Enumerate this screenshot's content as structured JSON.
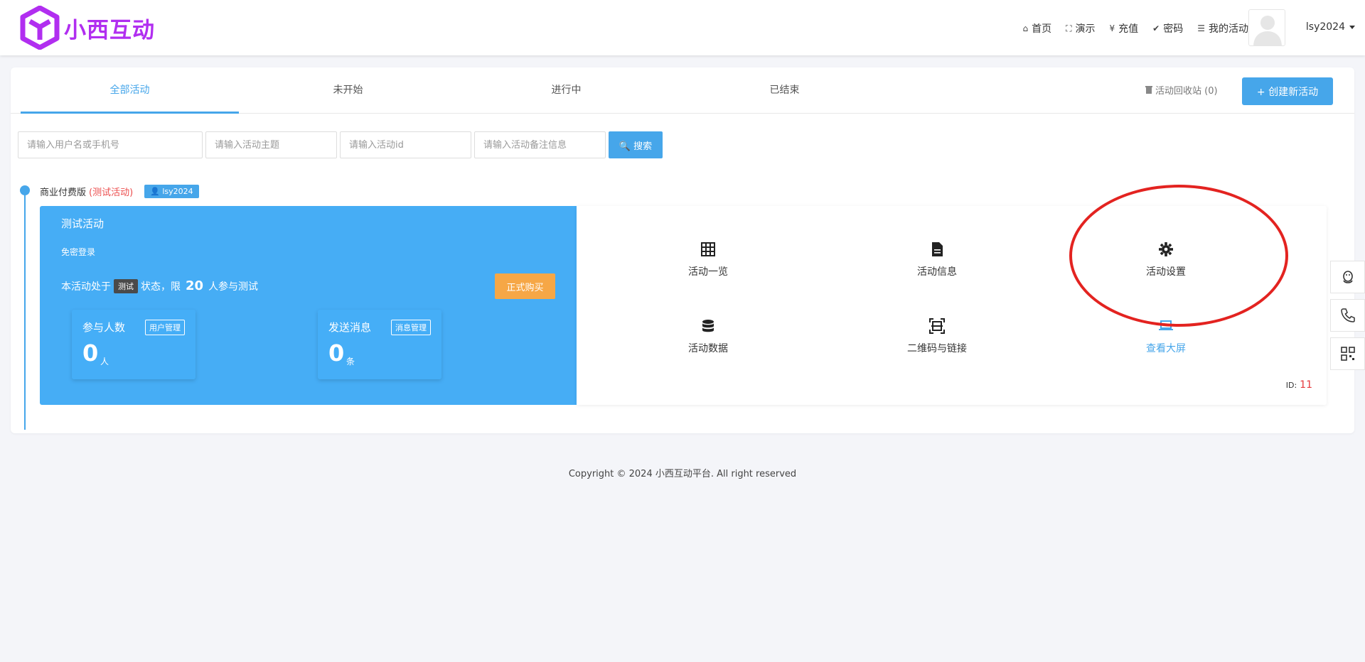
{
  "header": {
    "logo_text": "小西互动",
    "nav": [
      {
        "icon": "home-icon",
        "glyph": "⌂",
        "label": "首页"
      },
      {
        "icon": "fullscreen-icon",
        "glyph": "⛶",
        "label": "演示"
      },
      {
        "icon": "yen-icon",
        "glyph": "¥",
        "label": "充值"
      },
      {
        "icon": "check-circle-icon",
        "glyph": "✔",
        "label": "密码"
      },
      {
        "icon": "list-icon",
        "glyph": "☰",
        "label": "我的活动"
      }
    ],
    "username": "lsy2024"
  },
  "tabs": [
    "全部活动",
    "未开始",
    "进行中",
    "已结束"
  ],
  "recycle_label": "活动回收站 (0)",
  "create_label": "+ 创建新活动",
  "search": {
    "placeholders": [
      "请输入用户名或手机号",
      "请输入活动主题",
      "请输入活动id",
      "请输入活动备注信息"
    ],
    "button_label": "🔍 搜索"
  },
  "group": {
    "title": "商业付费版",
    "tag": "(测试活动)",
    "user": "lsy2024"
  },
  "activity": {
    "title": "测试活动",
    "login": "免密登录",
    "status_prefix": "本活动处于",
    "status_tag": "测试",
    "status_mid": "状态，限",
    "limit": "20",
    "status_suffix": "人参与测试",
    "buy_label": "正式购买",
    "stats": [
      {
        "label": "参与人数",
        "mgmt": "用户管理",
        "value": "0",
        "unit": "人"
      },
      {
        "label": "发送消息",
        "mgmt": "消息管理",
        "value": "0",
        "unit": "条"
      }
    ],
    "ops": [
      {
        "label": "活动一览",
        "icon": "grid-icon"
      },
      {
        "label": "活动信息",
        "icon": "document-icon"
      },
      {
        "label": "活动设置",
        "icon": "gear-icon"
      },
      {
        "label": "活动数据",
        "icon": "database-icon"
      },
      {
        "label": "二维码与链接",
        "icon": "qrcode-scan-icon"
      },
      {
        "label": "查看大屏",
        "icon": "laptop-icon"
      }
    ],
    "id_label": "ID:",
    "id_value": "11"
  },
  "footer": "Copyright © 2024 小西互动平台. All right reserved",
  "colors": {
    "primary": "#46a6ea",
    "logo": "#b12ef0",
    "buy": "#f6a746",
    "highlight": "#e32320"
  }
}
